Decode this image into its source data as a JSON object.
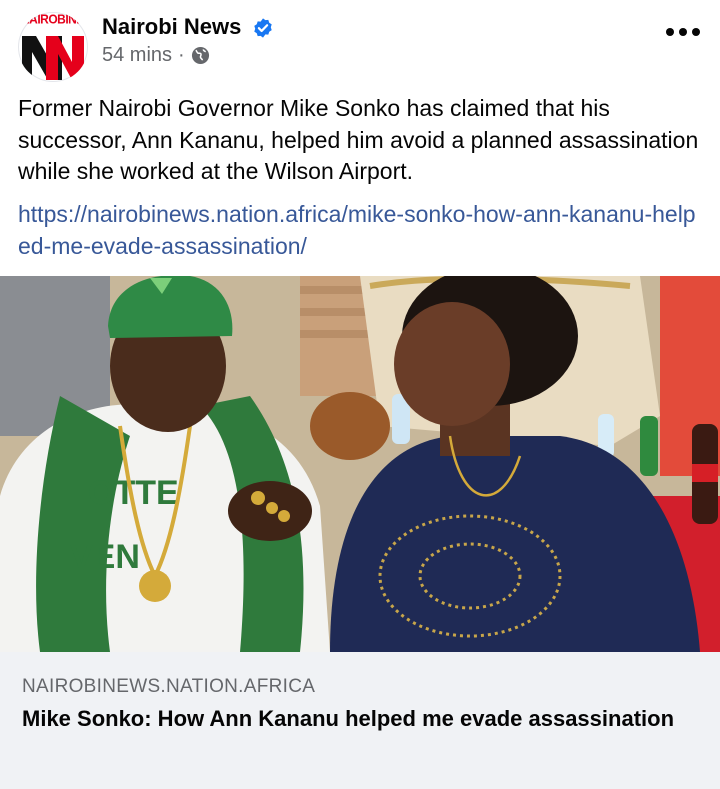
{
  "page": {
    "name": "Nairobi News",
    "avatar_brand": "NAIROBINEWS",
    "timestamp": "54 mins",
    "separator": "·",
    "audience_icon": "globe-icon",
    "verified_color": "#1877f2"
  },
  "post": {
    "text": "Former Nairobi Governor Mike Sonko has claimed that his successor, Ann Kananu, helped him avoid a planned assassination while she worked at the Wilson Airport.",
    "link": "https://nairobinews.nation.africa/mike-sonko-how-ann-kananu-helped-me-evade-assassination/"
  },
  "photo": {
    "shirt_text_line1": "OTTE",
    "shirt_text_line2": "VEN"
  },
  "preview": {
    "domain": "NAIROBINEWS.NATION.AFRICA",
    "title": "Mike Sonko: How Ann Kananu helped me evade assassination"
  },
  "colors": {
    "link": "#385898",
    "brand_red": "#e5001b",
    "secondary_text": "#65676b",
    "preview_bg": "#f0f2f5"
  }
}
